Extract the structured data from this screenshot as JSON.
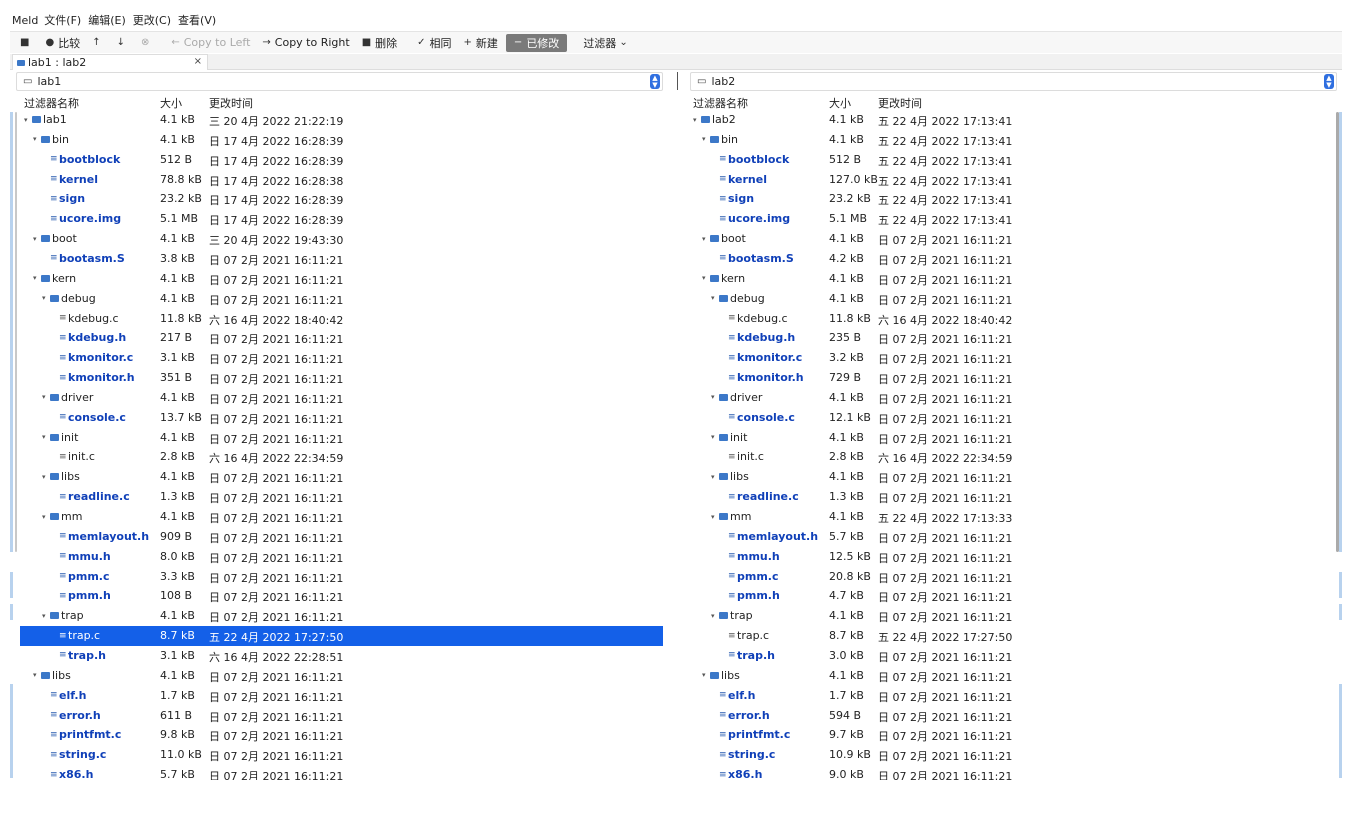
{
  "menubar": {
    "app": "Meld",
    "items": [
      "文件(F)",
      "编辑(E)",
      "更改(C)",
      "查看(V)"
    ]
  },
  "toolbar": {
    "compare": "比较",
    "copy_left": "Copy to Left",
    "copy_right": "Copy to Right",
    "delete": "删除",
    "same": "相同",
    "new": "新建",
    "modified": "已修改",
    "filter": "过滤器"
  },
  "tab": {
    "label": "lab1 : lab2",
    "close": "×"
  },
  "columns": {
    "name": "过滤器名称",
    "size": "大小",
    "mtime": "更改时间"
  },
  "left": {
    "path": "lab1",
    "rows": [
      {
        "d": 0,
        "type": "dir",
        "expanded": true,
        "name": "lab1",
        "size": "4.1 kB",
        "time": "三 20 4月 2022 21:22:19",
        "status": "normal"
      },
      {
        "d": 1,
        "type": "dir",
        "expanded": true,
        "name": "bin",
        "size": "4.1 kB",
        "time": "日 17 4月 2022 16:28:39",
        "status": "normal"
      },
      {
        "d": 2,
        "type": "file",
        "name": "bootblock",
        "size": "512 B",
        "time": "日 17 4月 2022 16:28:39",
        "status": "modified"
      },
      {
        "d": 2,
        "type": "file",
        "name": "kernel",
        "size": "78.8 kB",
        "time": "日 17 4月 2022 16:28:38",
        "status": "modified"
      },
      {
        "d": 2,
        "type": "file",
        "name": "sign",
        "size": "23.2 kB",
        "time": "日 17 4月 2022 16:28:39",
        "status": "modified"
      },
      {
        "d": 2,
        "type": "file",
        "name": "ucore.img",
        "size": "5.1 MB",
        "time": "日 17 4月 2022 16:28:39",
        "status": "modified"
      },
      {
        "d": 1,
        "type": "dir",
        "expanded": true,
        "name": "boot",
        "size": "4.1 kB",
        "time": "三 20 4月 2022 19:43:30",
        "status": "normal"
      },
      {
        "d": 2,
        "type": "file",
        "name": "bootasm.S",
        "size": "3.8 kB",
        "time": "日 07 2月 2021 16:11:21",
        "status": "modified"
      },
      {
        "d": 1,
        "type": "dir",
        "expanded": true,
        "name": "kern",
        "size": "4.1 kB",
        "time": "日 07 2月 2021 16:11:21",
        "status": "normal"
      },
      {
        "d": 2,
        "type": "dir",
        "expanded": true,
        "name": "debug",
        "size": "4.1 kB",
        "time": "日 07 2月 2021 16:11:21",
        "status": "normal"
      },
      {
        "d": 3,
        "type": "file",
        "name": "kdebug.c",
        "size": "11.8 kB",
        "time": "六 16 4月 2022 18:40:42",
        "status": "normal"
      },
      {
        "d": 3,
        "type": "file",
        "name": "kdebug.h",
        "size": "217 B",
        "time": "日 07 2月 2021 16:11:21",
        "status": "modified"
      },
      {
        "d": 3,
        "type": "file",
        "name": "kmonitor.c",
        "size": "3.1 kB",
        "time": "日 07 2月 2021 16:11:21",
        "status": "modified"
      },
      {
        "d": 3,
        "type": "file",
        "name": "kmonitor.h",
        "size": "351 B",
        "time": "日 07 2月 2021 16:11:21",
        "status": "modified"
      },
      {
        "d": 2,
        "type": "dir",
        "expanded": true,
        "name": "driver",
        "size": "4.1 kB",
        "time": "日 07 2月 2021 16:11:21",
        "status": "normal"
      },
      {
        "d": 3,
        "type": "file",
        "name": "console.c",
        "size": "13.7 kB",
        "time": "日 07 2月 2021 16:11:21",
        "status": "modified"
      },
      {
        "d": 2,
        "type": "dir",
        "expanded": true,
        "name": "init",
        "size": "4.1 kB",
        "time": "日 07 2月 2021 16:11:21",
        "status": "normal"
      },
      {
        "d": 3,
        "type": "file",
        "name": "init.c",
        "size": "2.8 kB",
        "time": "六 16 4月 2022 22:34:59",
        "status": "normal"
      },
      {
        "d": 2,
        "type": "dir",
        "expanded": true,
        "name": "libs",
        "size": "4.1 kB",
        "time": "日 07 2月 2021 16:11:21",
        "status": "normal"
      },
      {
        "d": 3,
        "type": "file",
        "name": "readline.c",
        "size": "1.3 kB",
        "time": "日 07 2月 2021 16:11:21",
        "status": "modified"
      },
      {
        "d": 2,
        "type": "dir",
        "expanded": true,
        "name": "mm",
        "size": "4.1 kB",
        "time": "日 07 2月 2021 16:11:21",
        "status": "normal"
      },
      {
        "d": 3,
        "type": "file",
        "name": "memlayout.h",
        "size": "909 B",
        "time": "日 07 2月 2021 16:11:21",
        "status": "modified"
      },
      {
        "d": 3,
        "type": "file",
        "name": "mmu.h",
        "size": "8.0 kB",
        "time": "日 07 2月 2021 16:11:21",
        "status": "modified"
      },
      {
        "d": 3,
        "type": "file",
        "name": "pmm.c",
        "size": "3.3 kB",
        "time": "日 07 2月 2021 16:11:21",
        "status": "modified"
      },
      {
        "d": 3,
        "type": "file",
        "name": "pmm.h",
        "size": "108 B",
        "time": "日 07 2月 2021 16:11:21",
        "status": "modified"
      },
      {
        "d": 2,
        "type": "dir",
        "expanded": true,
        "name": "trap",
        "size": "4.1 kB",
        "time": "日 07 2月 2021 16:11:21",
        "status": "normal"
      },
      {
        "d": 3,
        "type": "file",
        "name": "trap.c",
        "size": "8.7 kB",
        "time": "五 22 4月 2022 17:27:50",
        "status": "normal",
        "selected": true
      },
      {
        "d": 3,
        "type": "file",
        "name": "trap.h",
        "size": "3.1 kB",
        "time": "六 16 4月 2022 22:28:51",
        "status": "modified"
      },
      {
        "d": 1,
        "type": "dir",
        "expanded": true,
        "name": "libs",
        "size": "4.1 kB",
        "time": "日 07 2月 2021 16:11:21",
        "status": "normal"
      },
      {
        "d": 2,
        "type": "file",
        "name": "elf.h",
        "size": "1.7 kB",
        "time": "日 07 2月 2021 16:11:21",
        "status": "modified"
      },
      {
        "d": 2,
        "type": "file",
        "name": "error.h",
        "size": "611 B",
        "time": "日 07 2月 2021 16:11:21",
        "status": "modified"
      },
      {
        "d": 2,
        "type": "file",
        "name": "printfmt.c",
        "size": "9.8 kB",
        "time": "日 07 2月 2021 16:11:21",
        "status": "modified"
      },
      {
        "d": 2,
        "type": "file",
        "name": "string.c",
        "size": "11.0 kB",
        "time": "日 07 2月 2021 16:11:21",
        "status": "modified"
      },
      {
        "d": 2,
        "type": "file",
        "name": "x86.h",
        "size": "5.7 kB",
        "time": "日 07 2月 2021 16:11:21",
        "status": "modified"
      }
    ]
  },
  "right": {
    "path": "lab2",
    "rows": [
      {
        "d": 0,
        "type": "dir",
        "expanded": true,
        "name": "lab2",
        "size": "4.1 kB",
        "time": "五 22 4月 2022 17:13:41",
        "status": "normal"
      },
      {
        "d": 1,
        "type": "dir",
        "expanded": true,
        "name": "bin",
        "size": "4.1 kB",
        "time": "五 22 4月 2022 17:13:41",
        "status": "normal"
      },
      {
        "d": 2,
        "type": "file",
        "name": "bootblock",
        "size": "512 B",
        "time": "五 22 4月 2022 17:13:41",
        "status": "modified"
      },
      {
        "d": 2,
        "type": "file",
        "name": "kernel",
        "size": "127.0 kB",
        "time": "五 22 4月 2022 17:13:41",
        "status": "modified"
      },
      {
        "d": 2,
        "type": "file",
        "name": "sign",
        "size": "23.2 kB",
        "time": "五 22 4月 2022 17:13:41",
        "status": "modified"
      },
      {
        "d": 2,
        "type": "file",
        "name": "ucore.img",
        "size": "5.1 MB",
        "time": "五 22 4月 2022 17:13:41",
        "status": "modified"
      },
      {
        "d": 1,
        "type": "dir",
        "expanded": true,
        "name": "boot",
        "size": "4.1 kB",
        "time": "日 07 2月 2021 16:11:21",
        "status": "normal"
      },
      {
        "d": 2,
        "type": "file",
        "name": "bootasm.S",
        "size": "4.2 kB",
        "time": "日 07 2月 2021 16:11:21",
        "status": "modified"
      },
      {
        "d": 1,
        "type": "dir",
        "expanded": true,
        "name": "kern",
        "size": "4.1 kB",
        "time": "日 07 2月 2021 16:11:21",
        "status": "normal"
      },
      {
        "d": 2,
        "type": "dir",
        "expanded": true,
        "name": "debug",
        "size": "4.1 kB",
        "time": "日 07 2月 2021 16:11:21",
        "status": "normal"
      },
      {
        "d": 3,
        "type": "file",
        "name": "kdebug.c",
        "size": "11.8 kB",
        "time": "六 16 4月 2022 18:40:42",
        "status": "normal"
      },
      {
        "d": 3,
        "type": "file",
        "name": "kdebug.h",
        "size": "235 B",
        "time": "日 07 2月 2021 16:11:21",
        "status": "modified"
      },
      {
        "d": 3,
        "type": "file",
        "name": "kmonitor.c",
        "size": "3.2 kB",
        "time": "日 07 2月 2021 16:11:21",
        "status": "modified"
      },
      {
        "d": 3,
        "type": "file",
        "name": "kmonitor.h",
        "size": "729 B",
        "time": "日 07 2月 2021 16:11:21",
        "status": "modified"
      },
      {
        "d": 2,
        "type": "dir",
        "expanded": true,
        "name": "driver",
        "size": "4.1 kB",
        "time": "日 07 2月 2021 16:11:21",
        "status": "normal"
      },
      {
        "d": 3,
        "type": "file",
        "name": "console.c",
        "size": "12.1 kB",
        "time": "日 07 2月 2021 16:11:21",
        "status": "modified"
      },
      {
        "d": 2,
        "type": "dir",
        "expanded": true,
        "name": "init",
        "size": "4.1 kB",
        "time": "日 07 2月 2021 16:11:21",
        "status": "normal"
      },
      {
        "d": 3,
        "type": "file",
        "name": "init.c",
        "size": "2.8 kB",
        "time": "六 16 4月 2022 22:34:59",
        "status": "normal"
      },
      {
        "d": 2,
        "type": "dir",
        "expanded": true,
        "name": "libs",
        "size": "4.1 kB",
        "time": "日 07 2月 2021 16:11:21",
        "status": "normal"
      },
      {
        "d": 3,
        "type": "file",
        "name": "readline.c",
        "size": "1.3 kB",
        "time": "日 07 2月 2021 16:11:21",
        "status": "modified"
      },
      {
        "d": 2,
        "type": "dir",
        "expanded": true,
        "name": "mm",
        "size": "4.1 kB",
        "time": "五 22 4月 2022 17:13:33",
        "status": "normal"
      },
      {
        "d": 3,
        "type": "file",
        "name": "memlayout.h",
        "size": "5.7 kB",
        "time": "日 07 2月 2021 16:11:21",
        "status": "modified"
      },
      {
        "d": 3,
        "type": "file",
        "name": "mmu.h",
        "size": "12.5 kB",
        "time": "日 07 2月 2021 16:11:21",
        "status": "modified"
      },
      {
        "d": 3,
        "type": "file",
        "name": "pmm.c",
        "size": "20.8 kB",
        "time": "日 07 2月 2021 16:11:21",
        "status": "modified"
      },
      {
        "d": 3,
        "type": "file",
        "name": "pmm.h",
        "size": "4.7 kB",
        "time": "日 07 2月 2021 16:11:21",
        "status": "modified"
      },
      {
        "d": 2,
        "type": "dir",
        "expanded": true,
        "name": "trap",
        "size": "4.1 kB",
        "time": "日 07 2月 2021 16:11:21",
        "status": "normal"
      },
      {
        "d": 3,
        "type": "file",
        "name": "trap.c",
        "size": "8.7 kB",
        "time": "五 22 4月 2022 17:27:50",
        "status": "normal"
      },
      {
        "d": 3,
        "type": "file",
        "name": "trap.h",
        "size": "3.0 kB",
        "time": "日 07 2月 2021 16:11:21",
        "status": "modified"
      },
      {
        "d": 1,
        "type": "dir",
        "expanded": true,
        "name": "libs",
        "size": "4.1 kB",
        "time": "日 07 2月 2021 16:11:21",
        "status": "normal"
      },
      {
        "d": 2,
        "type": "file",
        "name": "elf.h",
        "size": "1.7 kB",
        "time": "日 07 2月 2021 16:11:21",
        "status": "modified"
      },
      {
        "d": 2,
        "type": "file",
        "name": "error.h",
        "size": "594 B",
        "time": "日 07 2月 2021 16:11:21",
        "status": "modified"
      },
      {
        "d": 2,
        "type": "file",
        "name": "printfmt.c",
        "size": "9.7 kB",
        "time": "日 07 2月 2021 16:11:21",
        "status": "modified"
      },
      {
        "d": 2,
        "type": "file",
        "name": "string.c",
        "size": "10.9 kB",
        "time": "日 07 2月 2021 16:11:21",
        "status": "modified"
      },
      {
        "d": 2,
        "type": "file",
        "name": "x86.h",
        "size": "9.0 kB",
        "time": "日 07 2月 2021 16:11:21",
        "status": "modified"
      }
    ]
  },
  "colors": {
    "modified_text": "#1040b8",
    "selection": "#1460e8",
    "folder": "#3c78c8"
  }
}
